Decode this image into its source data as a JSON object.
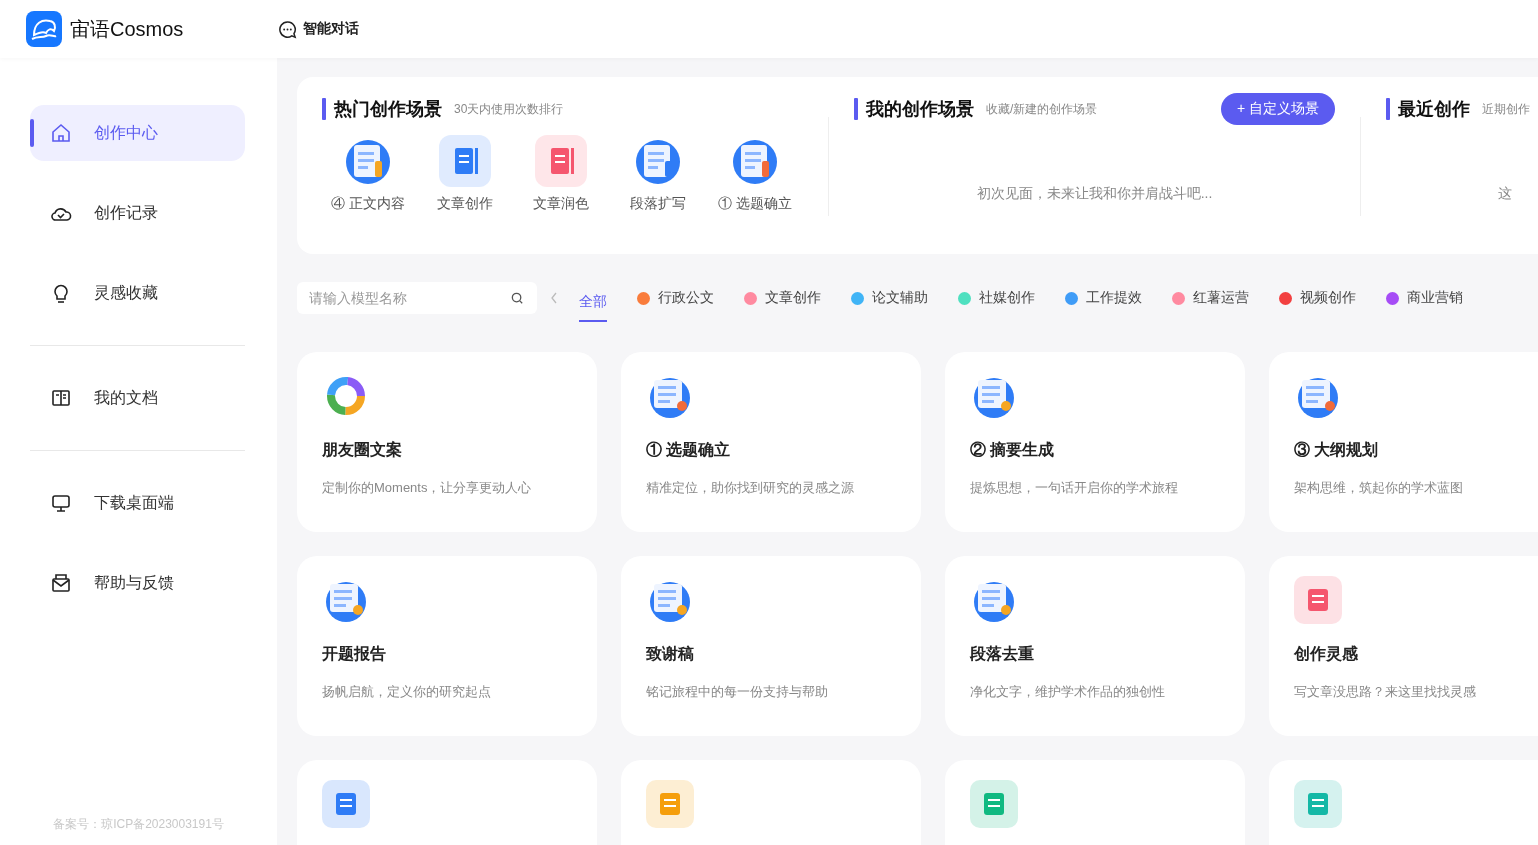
{
  "app": {
    "name": "宙语Cosmos"
  },
  "top_nav": [
    {
      "label": "智能对话"
    }
  ],
  "sidebar": {
    "groups": [
      [
        {
          "label": "创作中心",
          "kind": "home",
          "selected": true
        },
        {
          "label": "创作记录",
          "kind": "cloud",
          "selected": false
        },
        {
          "label": "灵感收藏",
          "kind": "bulb",
          "selected": false
        }
      ],
      [
        {
          "label": "我的文档",
          "kind": "book",
          "selected": false
        }
      ],
      [
        {
          "label": "下载桌面端",
          "kind": "monitor",
          "selected": false
        },
        {
          "label": "帮助与反馈",
          "kind": "mail",
          "selected": false
        }
      ]
    ],
    "footer": "备案号：琼ICP备2023003191号"
  },
  "hot_scenes": {
    "title": "热门创作场景",
    "subtitle": "30天内使用次数排行",
    "items": [
      {
        "label": "④ 正文内容",
        "kind": "doc",
        "color": "#f5a623"
      },
      {
        "label": "文章创作",
        "kind": "tile",
        "color": "#2f7cf6"
      },
      {
        "label": "文章润色",
        "kind": "tile",
        "color": "#f5566e"
      },
      {
        "label": "段落扩写",
        "kind": "doc",
        "color": "#2f7cf6"
      },
      {
        "label": "① 选题确立",
        "kind": "doc",
        "color": "#f26b3a"
      }
    ]
  },
  "my_scenes": {
    "title": "我的创作场景",
    "subtitle": "收藏/新建的创作场景",
    "button": "+ 自定义场景",
    "empty": "初次见面，未来让我和你并肩战斗吧..."
  },
  "recent": {
    "title": "最近创作",
    "subtitle": "近期创作",
    "empty": "这"
  },
  "search": {
    "placeholder": "请输入模型名称"
  },
  "categories": [
    {
      "label": "全部",
      "selected": true
    },
    {
      "label": "行政公文",
      "color": "#f97c3c",
      "selected": false
    },
    {
      "label": "文章创作",
      "color": "#ff8aa0",
      "selected": false
    },
    {
      "label": "论文辅助",
      "color": "#40b4f6",
      "selected": false
    },
    {
      "label": "社媒创作",
      "color": "#4fe0c0",
      "selected": false
    },
    {
      "label": "工作提效",
      "color": "#3f9cf7",
      "selected": false
    },
    {
      "label": "红薯运营",
      "color": "#ff8aa0",
      "selected": false
    },
    {
      "label": "视频创作",
      "color": "#f24040",
      "selected": false
    },
    {
      "label": "商业营销",
      "color": "#a64cf6",
      "selected": false
    }
  ],
  "cards": [
    {
      "title": "朋友圈文案",
      "description": "定制你的Moments，让分享更动人心",
      "kind": "ring",
      "color": "#4caf50"
    },
    {
      "title": "① 选题确立",
      "description": "精准定位，助你找到研究的灵感之源",
      "kind": "doc",
      "color": "#f26b3a"
    },
    {
      "title": "② 摘要生成",
      "description": "提炼思想，一句话开启你的学术旅程",
      "kind": "doc",
      "color": "#f5a623"
    },
    {
      "title": "③ 大纲规划",
      "description": "架构思维，筑起你的学术蓝图",
      "kind": "doc",
      "color": "#f26b3a"
    },
    {
      "title": "开题报告",
      "description": "扬帆启航，定义你的研究起点",
      "kind": "doc",
      "color": "#f5a623"
    },
    {
      "title": "致谢稿",
      "description": "铭记旅程中的每一份支持与帮助",
      "kind": "doc",
      "color": "#f5a623"
    },
    {
      "title": "段落去重",
      "description": "净化文字，维护学术作品的独创性",
      "kind": "doc",
      "color": "#f5a623"
    },
    {
      "title": "创作灵感",
      "description": "写文章没思路？来这里找找灵感",
      "kind": "tile",
      "color": "#f5566e"
    },
    {
      "kind": "tile",
      "color": "#2f7cf6"
    },
    {
      "kind": "tile",
      "color": "#f59e0b"
    },
    {
      "kind": "tile",
      "color": "#10b981"
    },
    {
      "kind": "tile",
      "color": "#14b8a6"
    }
  ]
}
